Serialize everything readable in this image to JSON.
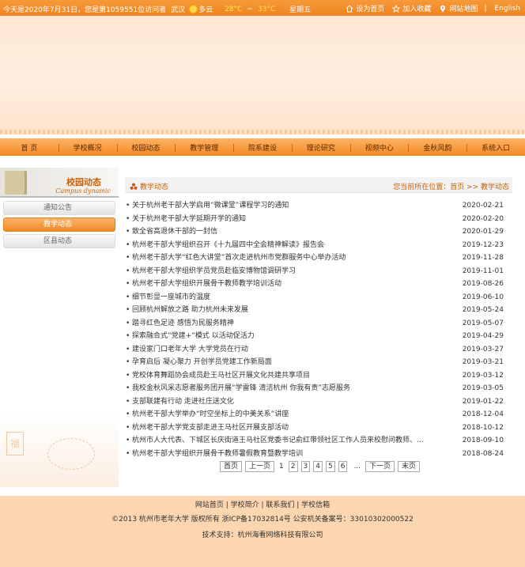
{
  "topbar": {
    "greeting": "今天是2020年7月31日，您是第1059551位访问者",
    "city": "武汉",
    "weather": "多云",
    "temp_low": "28°C",
    "temp_sep": "~",
    "temp_high": "33°C",
    "weekday": "星期五",
    "links": [
      "设为首页",
      "加入收藏",
      "网站地图",
      "English"
    ]
  },
  "nav": [
    "首 页",
    "学校概况",
    "校园动态",
    "教学管理",
    "院系建设",
    "理论研究",
    "视频中心",
    "金秋风韵",
    "系统入口"
  ],
  "sidebar": {
    "title": "校园动态",
    "subtitle": "Campus dynamic",
    "items": [
      "通知公告",
      "教学动态",
      "区县动态"
    ],
    "active_index": 1,
    "seal_char": "福"
  },
  "content": {
    "section_title": "教学动态",
    "location": "您当前所在位置：首页 >> 教学动态",
    "items": [
      {
        "title": "关于杭州老干部大学启用“微课堂”课程学习的通知",
        "date": "2020-02-21"
      },
      {
        "title": "关于杭州老干部大学延期开学的通知",
        "date": "2020-02-20"
      },
      {
        "title": "致全省高退休干部的一封信",
        "date": "2020-01-29"
      },
      {
        "title": "杭州老干部大学组织召开《十九届四中全会精神解读》报告会",
        "date": "2019-12-23"
      },
      {
        "title": "杭州老干部大学“红色大讲堂”首次走进杭州市党群服务中心举办活动",
        "date": "2019-11-28"
      },
      {
        "title": "杭州老干部大学组织学员党员赴临安博物馆调研学习",
        "date": "2019-11-01"
      },
      {
        "title": "杭州老干部大学组织开展骨干教师教学培训活动",
        "date": "2019-08-26"
      },
      {
        "title": "细节彰显一座城市的温度",
        "date": "2019-06-10"
      },
      {
        "title": "回顾杭州解放之路 助力杭州未来发展",
        "date": "2019-05-24"
      },
      {
        "title": "踏寻红色足迹 感悟为民服务精神",
        "date": "2019-05-07"
      },
      {
        "title": "探索融合式“党建+”模式 以活动促活力",
        "date": "2019-04-29"
      },
      {
        "title": "建设家门口老年大学 大学党员在行动",
        "date": "2019-03-27"
      },
      {
        "title": "孕育启后 凝心聚力 开创学员党建工作新局面",
        "date": "2019-03-21"
      },
      {
        "title": "党校体育舞蹈协会成员赴王马社区开展文化共建共享项目",
        "date": "2019-03-12"
      },
      {
        "title": "我校金秋风采志愿者服务团开展“学雷锋 清洁杭州 你我有责”志愿服务",
        "date": "2019-03-05"
      },
      {
        "title": "支部联建有行动 走进社庄送文化",
        "date": "2019-01-22"
      },
      {
        "title": "杭州老干部大学举办“时空坐标上的中美关系”讲座",
        "date": "2018-12-04"
      },
      {
        "title": "杭州老干部大学党支部走进王马社区开展支部活动",
        "date": "2018-10-12"
      },
      {
        "title": "杭州市人大代表、下城区长庆街道王马社区党委书记俞红带领社区工作人员来校慰问教师、...",
        "date": "2018-09-10"
      },
      {
        "title": "杭州老干部大学组织开展骨干教师暑假教育暨教学培训",
        "date": "2018-08-24"
      }
    ]
  },
  "pager": {
    "first": "首页",
    "prev": "上一页",
    "pages": [
      "1",
      "2",
      "3",
      "4",
      "5",
      "6"
    ],
    "current": "1",
    "ellipsis": "...",
    "next": "下一页",
    "last": "末页"
  },
  "footer": {
    "links_line": "网站首页 | 学校简介 | 联系我们 | 学校信箱",
    "copyright": "©2013 杭州市老年大学 版权所有 浙ICP备17032814号  公安机关备案号：33010302000522",
    "support": "技术支持：杭州海看网络科技有限公司"
  },
  "colors": {
    "accent": "#f08a24",
    "accent_dark": "#c8620a",
    "footer_bg": "#fcd6b0"
  }
}
